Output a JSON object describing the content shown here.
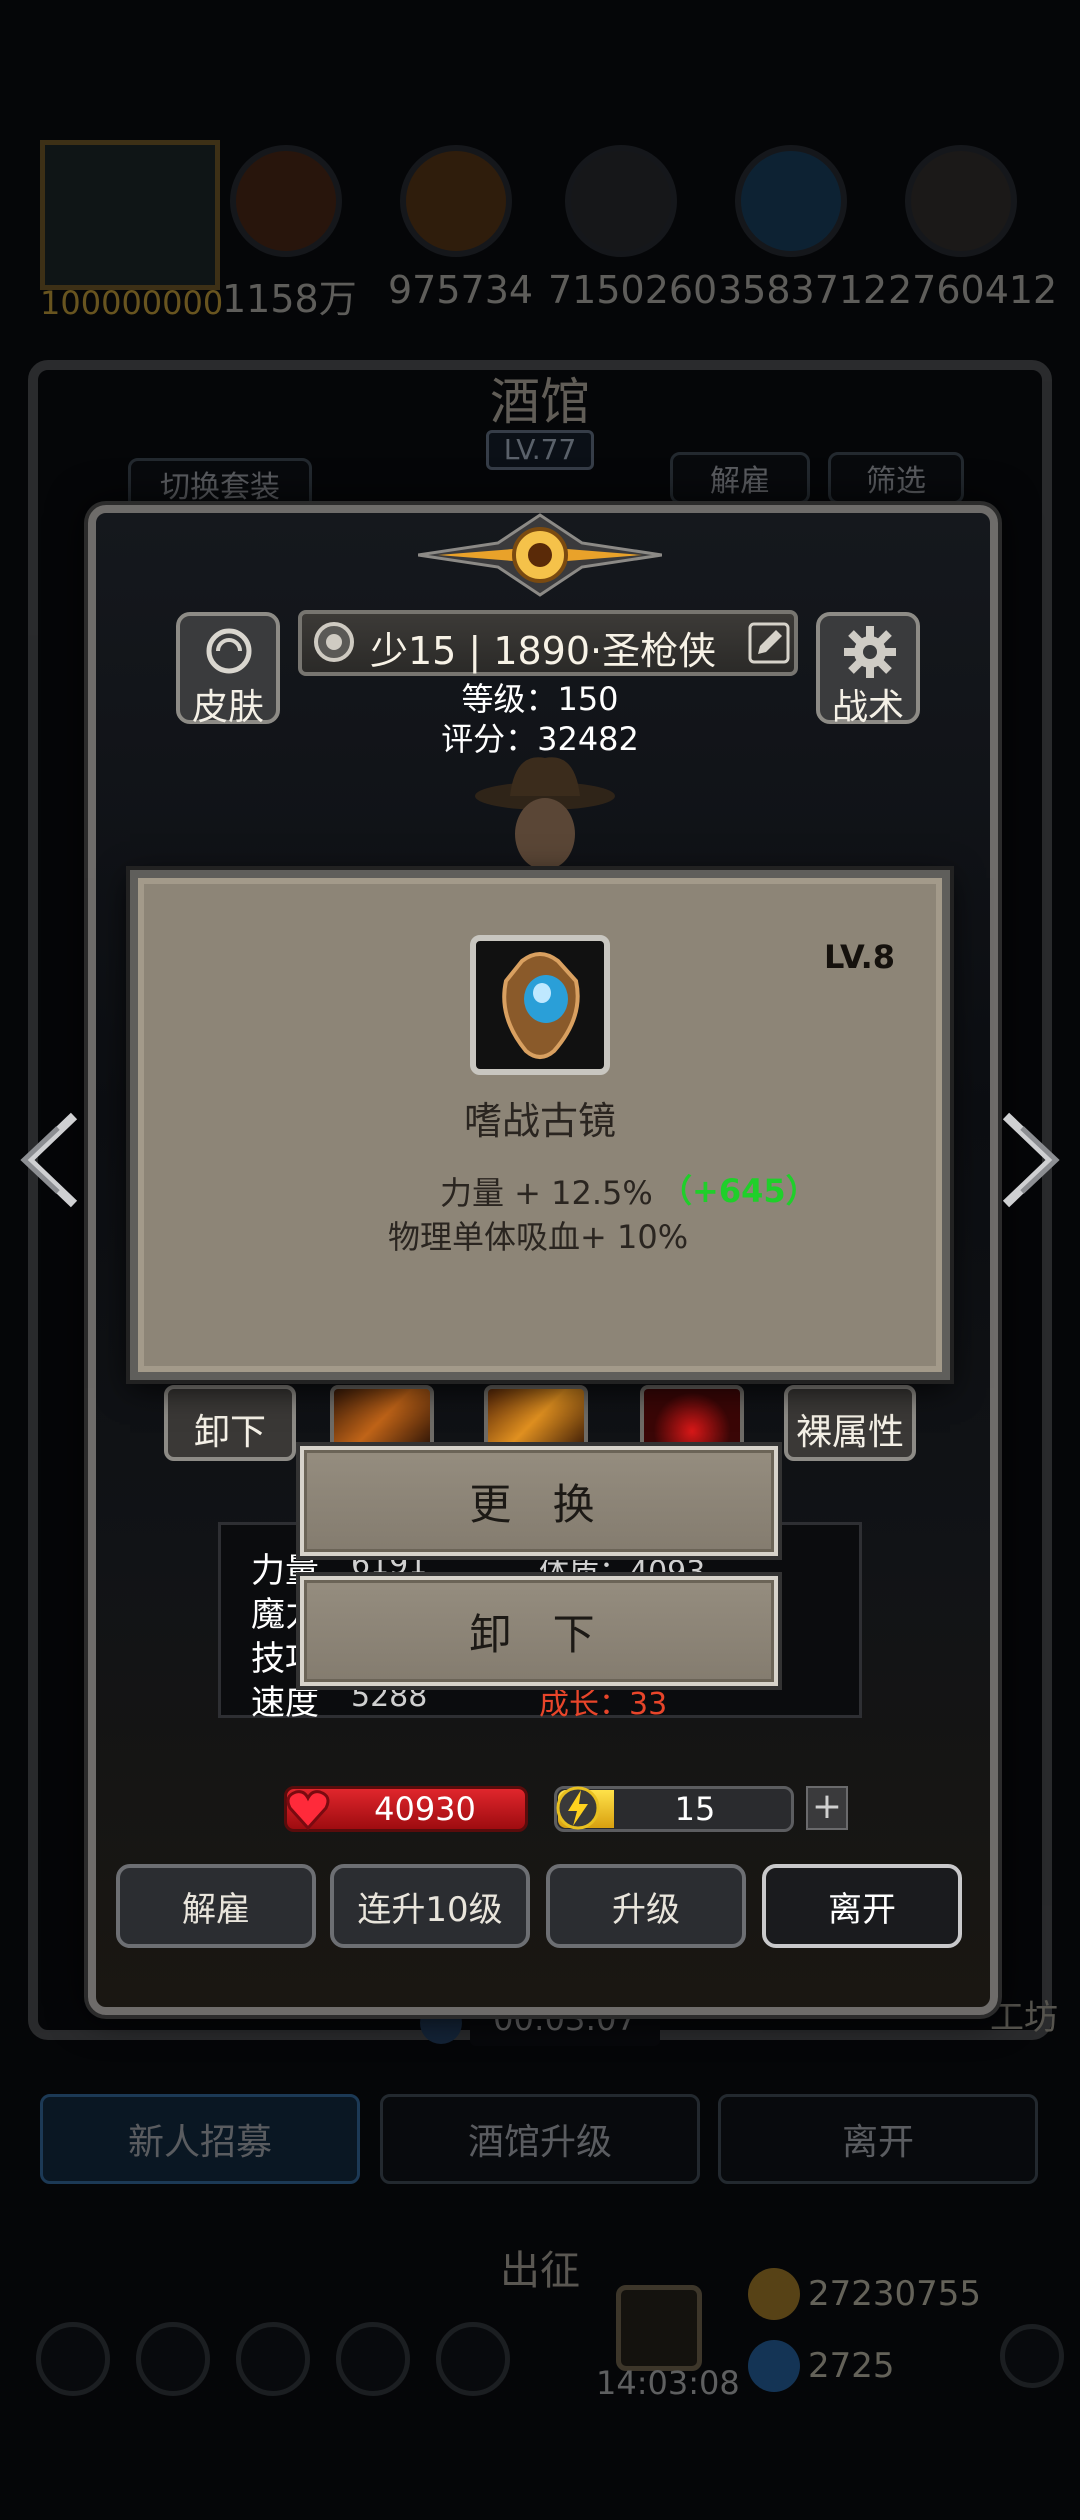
{
  "resources": {
    "first_value": "100000000",
    "values": [
      "1158万",
      "975734",
      "7150260",
      "3583712",
      "2760412"
    ]
  },
  "tavern": {
    "title": "酒馆",
    "level": "LV.77",
    "switch_outfit": "切换套装",
    "dismiss": "解雇",
    "filter": "筛选"
  },
  "hero": {
    "skin_label": "皮肤",
    "tactics_label": "战术",
    "name": "少15 | 1890·圣枪侠",
    "level_line": "等级：150",
    "score_line": "评分：32482"
  },
  "item": {
    "level": "LV.8",
    "name": "嗜战古镜",
    "attr1": "力量 + 12.5%",
    "attr1_bonus": "（+645）",
    "attr2": "物理单体吸血+ 10%"
  },
  "side_buttons": {
    "unequip": "卸下",
    "base_attributes": "裸属性"
  },
  "menu": {
    "replace": "更 换",
    "unequip": "卸 下"
  },
  "stats": {
    "row1_label": "力量",
    "row1_value": "6191",
    "row1_right": "体质：4093",
    "row2_label": "魔力",
    "row3_label": "技巧",
    "row4_label": "速度",
    "row4_value": "5288",
    "row4_right": "成长：33"
  },
  "bars": {
    "hp_value": "40930",
    "energy_value": "15",
    "plus": "+"
  },
  "actions": {
    "dismiss": "解雇",
    "level_up_10": "连升10级",
    "level_up": "升级",
    "leave": "离开"
  },
  "background": {
    "timer": "00:03:07",
    "recruit": "新人招募",
    "tavern_upgrade": "酒馆升级",
    "leave": "离开",
    "expedition": "出征",
    "gold": "27230755",
    "gems": "2725",
    "clock": "14:03:08",
    "side_label": "工坊"
  },
  "colors": {
    "hp_red": "#c8141a",
    "energy_yellow": "#f2c418",
    "bonus_green": "#1fcf2a",
    "growth_red": "#e8452a"
  }
}
